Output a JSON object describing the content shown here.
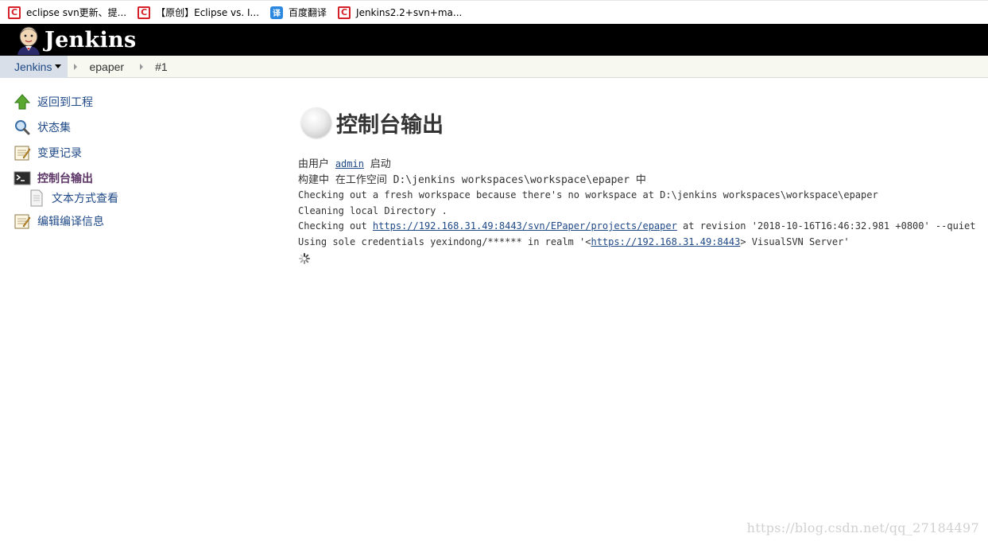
{
  "bookmarks": [
    {
      "label": "eclipse svn更新、提...",
      "icon": "csdn-icon"
    },
    {
      "label": "【原创】Eclipse vs. I...",
      "icon": "csdn-icon"
    },
    {
      "label": "百度翻译",
      "icon": "translate-icon"
    },
    {
      "label": "Jenkins2.2+svn+ma...",
      "icon": "csdn-icon"
    }
  ],
  "header": {
    "logo_text": "Jenkins"
  },
  "breadcrumbs": [
    "Jenkins",
    "epaper",
    "#1"
  ],
  "side_panel": [
    {
      "label": "返回到工程",
      "icon": "up-arrow-icon"
    },
    {
      "label": "状态集",
      "icon": "magnifier-icon"
    },
    {
      "label": "变更记录",
      "icon": "notepad-icon"
    },
    {
      "label": "控制台输出",
      "icon": "terminal-icon"
    },
    {
      "label": "文本方式查看",
      "icon": "document-icon"
    },
    {
      "label": "编辑编译信息",
      "icon": "notepad-icon"
    }
  ],
  "main": {
    "title": "控制台输出",
    "started_by_prefix": "由用户 ",
    "started_by_user": "admin",
    "started_by_suffix": " 启动",
    "building_line": "构建中 在工作空间 D:\\jenkins workspaces\\workspace\\epaper 中",
    "log_line_1": "Checking out a fresh workspace because there's no workspace at D:\\jenkins workspaces\\workspace\\epaper",
    "log_line_2": "Cleaning local Directory .",
    "log_line_3_prefix": "Checking out ",
    "log_line_3_url": "https://192.168.31.49:8443/svn/EPaper/projects/epaper",
    "log_line_3_suffix": " at revision '2018-10-16T16:46:32.981 +0800' --quiet",
    "log_line_4_prefix": "Using sole credentials yexindong/****** in realm  '<",
    "log_line_4_url": "https://192.168.31.49:8443",
    "log_line_4_suffix": "> VisualSVN Server'"
  },
  "watermark": "https://blog.csdn.net/qq_27184497",
  "colors": {
    "link": "#204a87",
    "header_bg": "#000000",
    "breadcrumb_bg": "#f7f9f1"
  }
}
